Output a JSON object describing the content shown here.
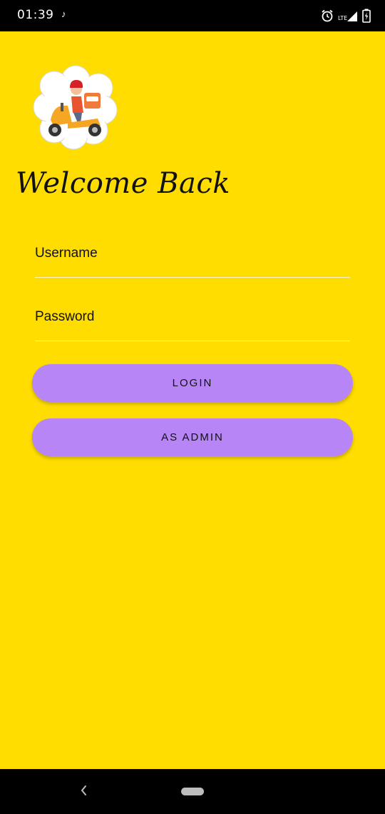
{
  "status_bar": {
    "time": "01:39",
    "notification_icon": "tiktok-icon",
    "icons": [
      "alarm-icon",
      "signal-icon",
      "battery-charging-icon"
    ]
  },
  "screen": {
    "background_color": "#FFDD00",
    "logo_icon": "delivery-scooter-icon",
    "welcome_text": "Welcome Back"
  },
  "form": {
    "username_placeholder": "Username",
    "password_placeholder": "Password"
  },
  "buttons": {
    "login_label": "LOGIN",
    "admin_label": "AS ADMIN",
    "color": "#B885F7"
  },
  "nav_bar": {
    "icons": [
      "back-icon",
      "home-pill-icon"
    ]
  }
}
